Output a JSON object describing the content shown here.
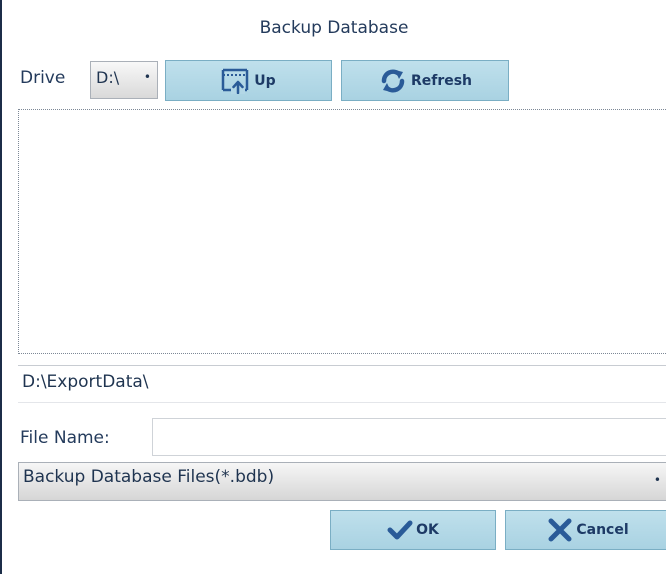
{
  "dialog": {
    "title": "Backup Database"
  },
  "drive": {
    "label": "Drive",
    "selected": "D:\\",
    "arrow": "•"
  },
  "toolbar": {
    "up_label": "Up",
    "up_icon": "folder-up-icon",
    "refresh_label": "Refresh",
    "refresh_icon": "refresh-icon"
  },
  "file_list": {
    "items": []
  },
  "current_path": "D:\\ExportData\\",
  "file_name": {
    "label": "File Name:",
    "value": ""
  },
  "file_type": {
    "selected": "Backup Database Files(*.bdb)",
    "arrow": "•"
  },
  "actions": {
    "ok_label": "OK",
    "ok_icon": "check-icon",
    "cancel_label": "Cancel",
    "cancel_icon": "close-icon"
  },
  "colors": {
    "button_fill": "#b3d7e6",
    "icon_blue": "#2a5b98",
    "text": "#1f3450"
  }
}
